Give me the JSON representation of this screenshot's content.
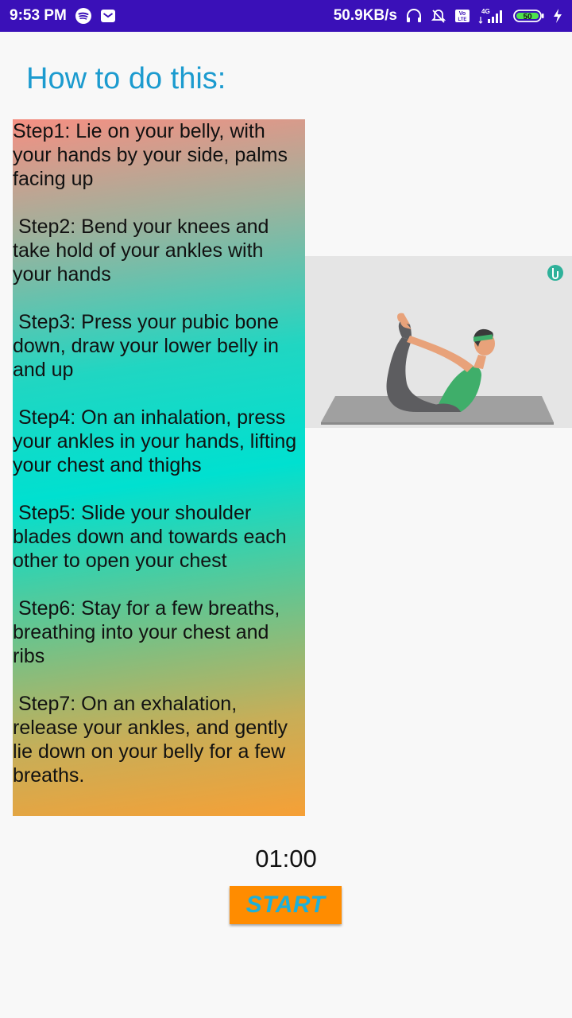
{
  "status_bar": {
    "time": "9:53 PM",
    "network_speed": "50.9KB/s",
    "signal_label": "4G",
    "volte_label": "Vo LTE",
    "battery": "50",
    "icons": [
      "spotify-icon",
      "mail-icon",
      "headset-icon",
      "alarm-off-icon",
      "volte-icon",
      "signal-icon",
      "battery-icon",
      "charging-icon"
    ]
  },
  "heading": "How to do this:",
  "steps": [
    "Step1: Lie on your belly, with your hands by your side, palms facing up",
    " Step2: Bend your knees and take hold of your ankles with your hands",
    " Step3: Press your pubic bone down, draw your lower belly in and up",
    " Step4: On an inhalation, press your ankles in your hands, lifting your chest and thighs",
    " Step5: Slide your shoulder blades down and towards each other to open your chest",
    " Step6: Stay for a few breaths, breathing into your chest and ribs",
    " Step7: On an exhalation, release your ankles, and gently lie down on your belly for a few breaths."
  ],
  "image": {
    "description": "bow-pose-illustration",
    "colors": {
      "background": "#e5e5e5",
      "mat": "#9c9c9c",
      "top": "#3fae6a",
      "pants": "#5d5d60",
      "skin": "#e8a27a"
    }
  },
  "timer": "01:00",
  "start_button": "START",
  "colors": {
    "status_bar": "#3a10b8",
    "heading": "#1c9bcf",
    "button_bg": "#ff8c00",
    "button_text": "#1eb0d8"
  }
}
